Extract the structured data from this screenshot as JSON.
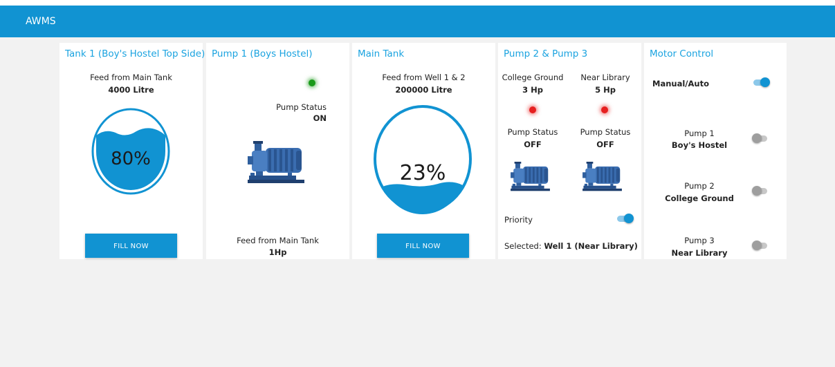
{
  "appbar": {
    "title": "AWMS"
  },
  "colors": {
    "brand": "#1193d2",
    "title_text": "#1aa3e0",
    "led_on": "#1a9a1a",
    "led_off": "#e62020",
    "water": "#1193d2"
  },
  "tank1": {
    "title": "Tank 1 (Boy's Hostel Top Side)",
    "feed_label": "Feed from Main Tank",
    "capacity": "4000 Litre",
    "level_text": "80%",
    "level": 0.8,
    "button_label": "FILL NOW"
  },
  "pump1": {
    "title": "Pump 1 (Boys Hostel)",
    "led": "green-led-icon",
    "status_label": "Pump Status",
    "status_value": "ON",
    "icon": "water-pump-icon",
    "feed_label": "Feed from Main Tank",
    "power": "1Hp"
  },
  "main_tank": {
    "title": "Main Tank",
    "feed_label": "Feed from Well 1 & 2",
    "capacity": "200000 Litre",
    "level_text": "23%",
    "level": 0.23,
    "button_label": "FILL NOW"
  },
  "pump23": {
    "title": "Pump 2 & Pump 3",
    "pumps": [
      {
        "location": "College Ground",
        "power": "3 Hp",
        "status_label": "Pump Status",
        "status_value": "OFF"
      },
      {
        "location": "Near Library",
        "power": "5 Hp",
        "status_label": "Pump Status",
        "status_value": "OFF"
      }
    ],
    "priority_label": "Priority",
    "priority_on": true,
    "selected_label": "Selected: ",
    "selected_value": "Well 1 (Near Library)"
  },
  "motor_control": {
    "title": "Motor Control",
    "manual_auto_label": "Manual/Auto",
    "manual_auto_on": true,
    "pumps": [
      {
        "name": "Pump 1",
        "location": "Boy's Hostel",
        "on": false
      },
      {
        "name": "Pump 2",
        "location": "College Ground",
        "on": false
      },
      {
        "name": "Pump 3",
        "location": "Near Library",
        "on": false
      }
    ]
  }
}
